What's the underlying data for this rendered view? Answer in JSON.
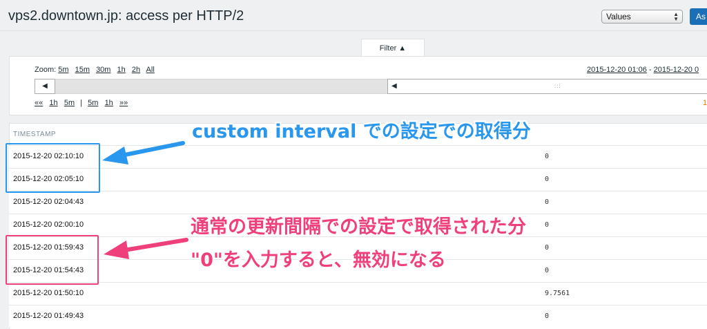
{
  "header": {
    "title": "vps2.downtown.jp: access per HTTP/2",
    "view_select": "Values",
    "as_button": "As"
  },
  "filter": {
    "tab_label": "Filter ▲",
    "zoom_label": "Zoom:",
    "zoom_options": [
      "5m",
      "15m",
      "30m",
      "1h",
      "2h",
      "All"
    ],
    "range_start": "2015-12-20 01:06",
    "range_sep": " - ",
    "range_end": "2015-12-20 0",
    "nav": {
      "back_all": "««",
      "back_1h": "1h",
      "back_5m": "5m",
      "divider": "|",
      "fwd_5m": "5m",
      "fwd_1h": "1h",
      "fwd_all": "»»"
    },
    "nav_right_digit": "1",
    "timeline_left_arrow": "◀",
    "timeline_window_arrow": "◀",
    "timeline_grip": ":::"
  },
  "table": {
    "header_timestamp": "TIMESTAMP",
    "rows": [
      {
        "timestamp": "2015-12-20 02:10:10",
        "value": "0"
      },
      {
        "timestamp": "2015-12-20 02:05:10",
        "value": "0"
      },
      {
        "timestamp": "2015-12-20 02:04:43",
        "value": "0"
      },
      {
        "timestamp": "2015-12-20 02:00:10",
        "value": "0"
      },
      {
        "timestamp": "2015-12-20 01:59:43",
        "value": "0"
      },
      {
        "timestamp": "2015-12-20 01:54:43",
        "value": "0"
      },
      {
        "timestamp": "2015-12-20 01:50:10",
        "value": "9.7561"
      },
      {
        "timestamp": "2015-12-20 01:49:43",
        "value": "0"
      }
    ]
  },
  "annotations": {
    "blue_note": "custom interval での設定での取得分",
    "pink_note_line1": "通常の更新間隔での設定で取得された分",
    "pink_note_line2": "\"0\"を入力すると、無効になる",
    "blue_color": "#2a97ee",
    "pink_color": "#f0407c"
  }
}
